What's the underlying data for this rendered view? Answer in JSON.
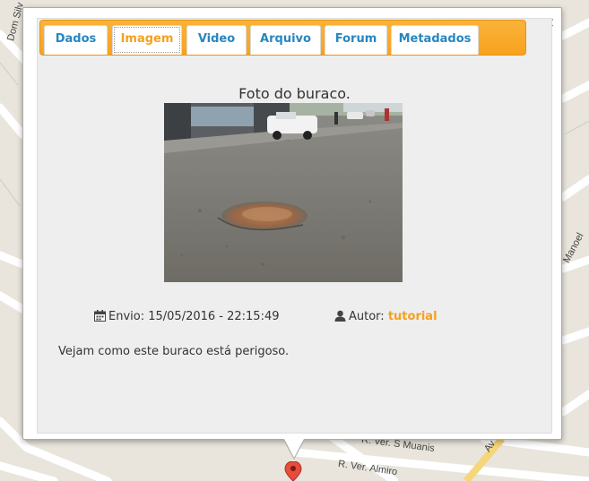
{
  "map": {
    "street_labels": [
      "Dom Silv",
      "...",
      "Manoel",
      "R. Ver. S Muanis",
      "R. Ver. Almiro",
      "Av"
    ]
  },
  "popup": {
    "close_label": "×",
    "tabs": [
      {
        "label": "Dados",
        "active": false
      },
      {
        "label": "Imagem",
        "active": true
      },
      {
        "label": "Video",
        "active": false
      },
      {
        "label": "Arquivo",
        "active": false
      },
      {
        "label": "Forum",
        "active": false
      },
      {
        "label": "Metadados",
        "active": false
      }
    ],
    "title": "Foto do buraco.",
    "envio_label": "Envio:",
    "envio_value": "15/05/2016 - 22:15:49",
    "autor_label": "Autor:",
    "autor_value": "tutorial",
    "description": "Vejam como este buraco está perigoso."
  },
  "colors": {
    "tabbar": "#f7a21e",
    "tab_text": "#2786c0",
    "active_tab_text": "#f3a021",
    "panel_bg": "#eeeeee",
    "marker": "#e74c3c"
  },
  "icons": {
    "close": "close-icon",
    "calendar": "calendar-icon",
    "user": "user-icon",
    "marker": "map-marker-icon"
  }
}
